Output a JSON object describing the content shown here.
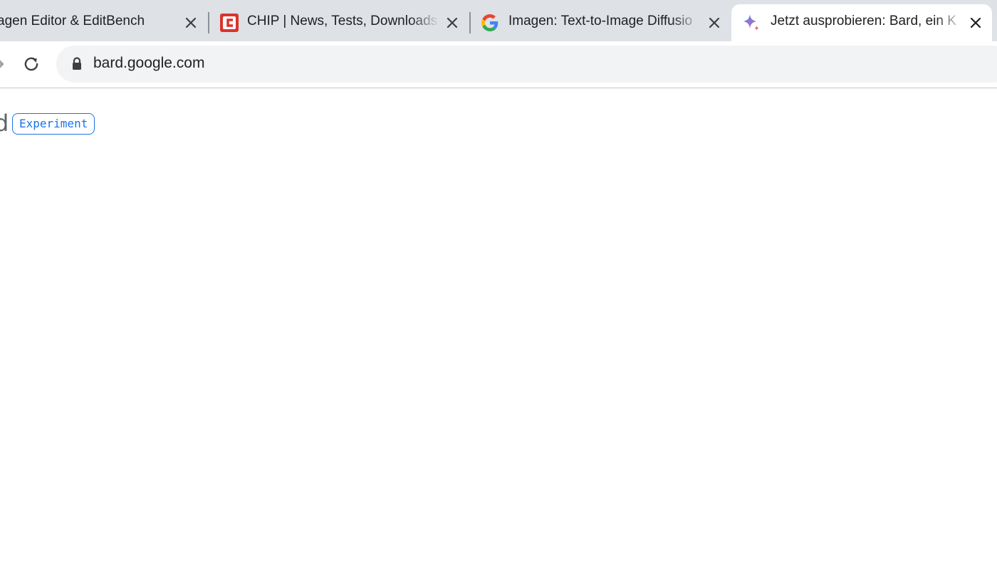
{
  "tabs": [
    {
      "title": "agen Editor & EditBench",
      "active": false,
      "favicon": "none"
    },
    {
      "title": "CHIP | News, Tests, Downloads",
      "active": false,
      "favicon": "chip-logo-icon"
    },
    {
      "title": "Imagen: Text-to-Image Diffusio",
      "active": false,
      "favicon": "google-g-icon"
    },
    {
      "title": "Jetzt ausprobieren: Bard, ein K",
      "active": true,
      "favicon": "bard-sparkle-icon"
    }
  ],
  "omnibox": {
    "url": "bard.google.com"
  },
  "page": {
    "brand_tail": "d",
    "badge": "Experiment"
  },
  "colors": {
    "tabstrip_bg": "#dee1e6",
    "accent_blue": "#1a73e8",
    "chip_red": "#d9342b"
  }
}
